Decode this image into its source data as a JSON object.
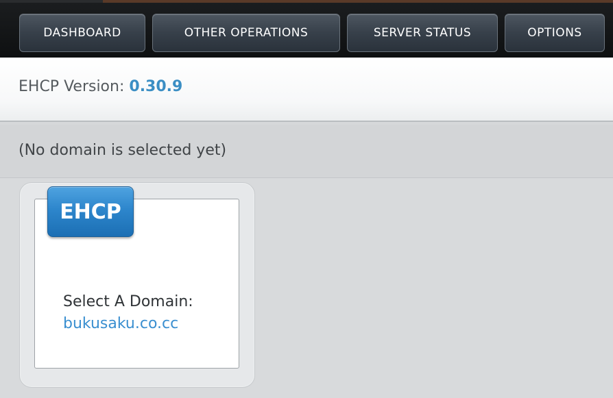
{
  "nav": {
    "items": [
      {
        "label": "DASHBOARD"
      },
      {
        "label": "OTHER OPERATIONS"
      },
      {
        "label": "SERVER STATUS"
      },
      {
        "label": "OPTIONS"
      }
    ]
  },
  "version": {
    "label": "EHCP Version:",
    "value": "0.30.9"
  },
  "notice": {
    "text": "(No domain is selected yet)"
  },
  "card": {
    "badge": "EHCP",
    "select_label": "Select A Domain:",
    "domain": "bukusaku.co.cc"
  },
  "colors": {
    "accent_blue": "#3b8ec4",
    "link_blue": "#3a8fd0",
    "badge_blue": "#2d86cc",
    "nav_dark": "#0e1011"
  }
}
